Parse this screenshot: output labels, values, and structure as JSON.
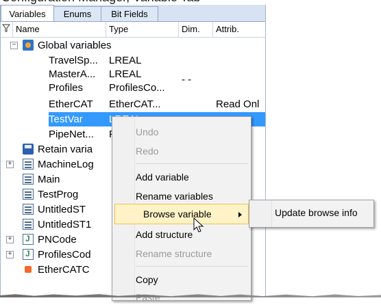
{
  "caption": "Configuration Manager, Variable Tab",
  "tabs": [
    "Variables",
    "Enums",
    "Bit Fields"
  ],
  "columns": {
    "name": "Name",
    "type": "Type",
    "dim": "Dim.",
    "attrib": "Attrib."
  },
  "tree": {
    "global": "Global variables",
    "vars": [
      {
        "name": "TravelSp...",
        "type": "LREAL",
        "dim": "",
        "attrib": ""
      },
      {
        "name": "MasterA...",
        "type": "LREAL",
        "dim": "-",
        "attrib": ""
      },
      {
        "name": "Profiles",
        "type": "ProfilesCo...",
        "dim": "",
        "attrib": ""
      },
      {
        "name": "EtherCAT",
        "type": "EtherCAT...",
        "dim": "",
        "attrib": "Read Onl"
      },
      {
        "name": "TestVar",
        "type": "LREAL",
        "dim": "",
        "attrib": ""
      },
      {
        "name": "PipeNet...",
        "type": "P",
        "dim": "",
        "attrib": ""
      }
    ],
    "dim_marks": "-  -",
    "nodes": [
      {
        "label": "Retain varia",
        "icon": "save-icon"
      },
      {
        "label": "MachineLog",
        "icon": "sheet-icon"
      },
      {
        "label": "Main",
        "icon": "sheet-icon"
      },
      {
        "label": "TestProg",
        "icon": "sheet-icon"
      },
      {
        "label": "UntitledST",
        "icon": "sheet-icon"
      },
      {
        "label": "UntitledST1",
        "icon": "sheet-icon"
      },
      {
        "label": "PNCode",
        "icon": "pn-icon"
      },
      {
        "label": "ProfilesCod",
        "icon": "pn-icon"
      },
      {
        "label": "EtherCATC",
        "icon": "ethercat-icon"
      }
    ]
  },
  "menu": {
    "undo": "Undo",
    "redo": "Redo",
    "add_variable": "Add variable",
    "rename_variables": "Rename variables",
    "browse_variable": "Browse variable",
    "add_structure": "Add structure",
    "rename_structure": "Rename structure",
    "copy": "Copy",
    "paste": "Paste"
  },
  "submenu": {
    "update_browse_info": "Update browse info"
  }
}
